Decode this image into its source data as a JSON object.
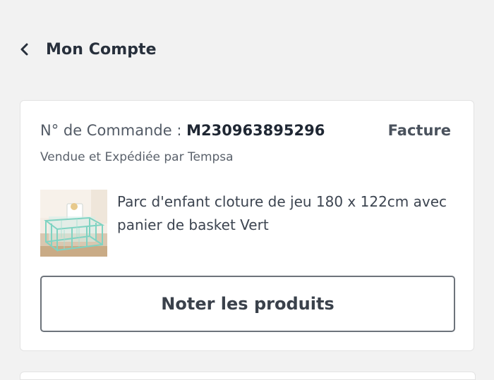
{
  "nav": {
    "back_label": "Mon Compte"
  },
  "order": {
    "number_label": "N° de Commande : ",
    "number_value": "M230963895296",
    "invoice_label": "Facture",
    "seller_text": "Vendue et Expédiée par Tempsa",
    "product": {
      "title": "Parc d'enfant cloture de jeu 180 x 122cm avec panier de basket Vert",
      "image_icon": "playpen-product-thumbnail"
    },
    "rate_button_label": "Noter les produits"
  },
  "colors": {
    "background": "#f2f2f2",
    "card": "#ffffff",
    "text_primary": "#2c3440",
    "button_border": "#6d737b"
  }
}
